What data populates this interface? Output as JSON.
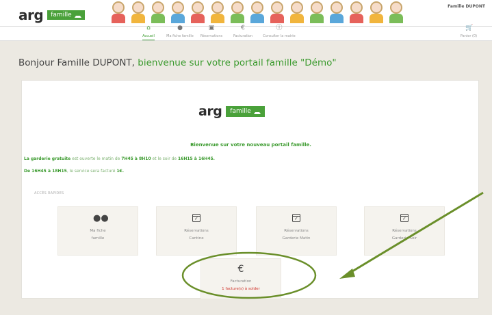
{
  "header": {
    "logo_word": "arg",
    "logo_badge": "famille",
    "user_name": "Famille DUPONT",
    "nav": [
      {
        "label": "Accueil",
        "icon": "home-icon"
      },
      {
        "label": "Ma fiche famille",
        "icon": "family-icon"
      },
      {
        "label": "Réservations",
        "icon": "calendar-icon"
      },
      {
        "label": "Facturation",
        "icon": "euro-icon"
      },
      {
        "label": "Consulter la mairie",
        "icon": "info-icon"
      },
      {
        "label": "Panier (0)",
        "icon": "cart-icon"
      }
    ]
  },
  "greeting": {
    "prefix": "Bonjour Famille DUPONT, ",
    "suffix": "bienvenue sur votre portail famille \"Démo\""
  },
  "panel": {
    "logo_word": "arg",
    "logo_badge": "famille",
    "welcome": "Bienvenue sur votre nouveau portail famille.",
    "info1_a": "La garderie gratuite",
    "info1_b": " est ouverte le matin de ",
    "info1_c": "7H45 à 8H10",
    "info1_d": " et le soir de ",
    "info1_e": "16H15 à 16H45.",
    "info2_a": "De 16H45 à 18H15",
    "info2_b": ", le service sera facturé ",
    "info2_c": "1€.",
    "acces_label": "ACCÈS RAPIDES",
    "tiles": [
      {
        "line1": "Ma fiche",
        "line2": "famille"
      },
      {
        "line1": "Réservations",
        "line2": "Cantine"
      },
      {
        "line1": "Réservations",
        "line2": "Garderie Matin"
      },
      {
        "line1": "Réservations",
        "line2": "Garderie Soir"
      },
      {
        "line1": "Facturation",
        "line2": "1 facture(s) à solder"
      }
    ]
  },
  "colors": {
    "accent_green": "#3a9a2d",
    "annotation_green": "#6a8f2a",
    "due_red": "#d0322a"
  }
}
